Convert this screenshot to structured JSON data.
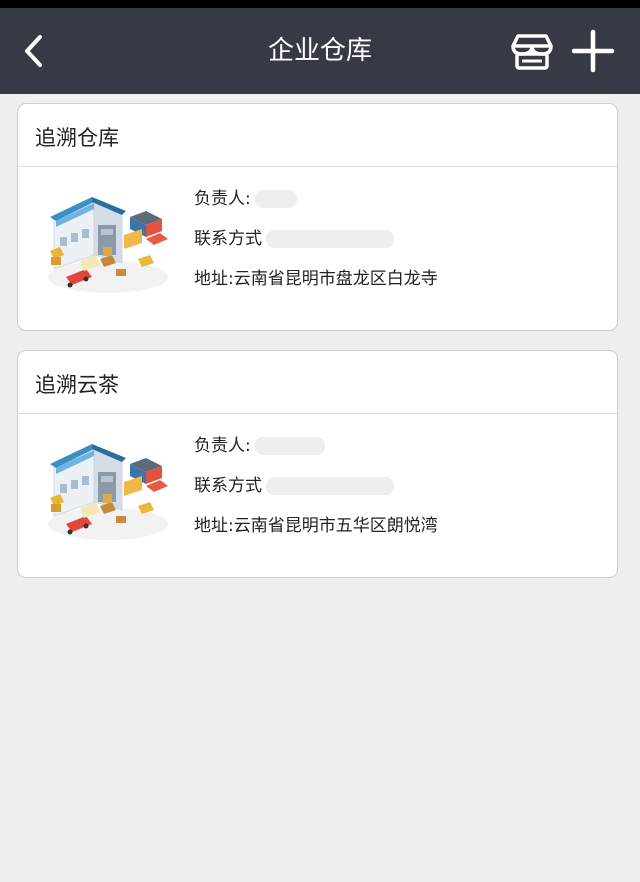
{
  "header": {
    "title": "企业仓库"
  },
  "warehouses": [
    {
      "name": "追溯仓库",
      "manager_label": "负责人:",
      "contact_label": "联系方式",
      "address": "地址:云南省昆明市盘龙区白龙寺"
    },
    {
      "name": "追溯云茶",
      "manager_label": "负责人:",
      "contact_label": "联系方式",
      "address": "地址:云南省昆明市五华区朗悦湾"
    }
  ],
  "icons": {
    "back": "chevron-left-icon",
    "store": "store-icon",
    "add": "plus-icon",
    "warehouse": "warehouse-illustration"
  },
  "colors": {
    "navbar": "#363a44",
    "background": "#efefef",
    "card": "#ffffff"
  }
}
